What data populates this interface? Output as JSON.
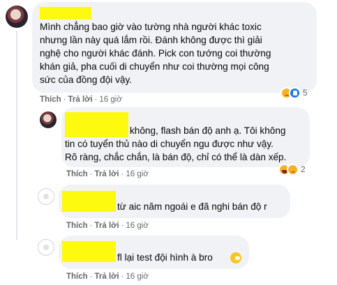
{
  "comments": [
    {
      "lines": [
        "Mình chẳng bao giờ vào tường nhà người khác toxic",
        "nhưng lần này quá lắm rồi. Đánh không được thì giải",
        "nghệ cho người khác đánh. Pick con tướng coi thường",
        "khán giả, pha cuối di chuyển như coi thường mọi công",
        "sức của đồng đội vậy."
      ],
      "like_label": "Thích",
      "reply_label": "Trả lời",
      "time": "16 giờ",
      "reaction_icons": [
        "sad-reaction-icon",
        "like-reaction-icon"
      ],
      "reaction_count": "5"
    },
    {
      "lines": [
        "không, flash bán độ anh ạ. Tôi không",
        "tin có tuyển thủ nào di chuyển ngu được như vậy.",
        "Rõ ràng, chắc chắn, là bán độ, chỉ có thể là dàn xếp."
      ],
      "like_label": "Thích",
      "reply_label": "Trả lời",
      "time": "16 giờ",
      "reaction_icons": [
        "laugh-reaction-icon",
        "sad-reaction-icon"
      ],
      "reaction_count": "2"
    },
    {
      "lines": [
        "từ aic năm ngoái e đã nghi bán độ r"
      ],
      "like_label": "Thích",
      "reply_label": "Trả lời",
      "time": "16 giờ"
    },
    {
      "lines": [
        "fl lại test đội hình à bro"
      ],
      "like_label": "Thích",
      "reply_label": "Trả lời",
      "time": "16 giờ",
      "inline_emoji": "grin-emoji-icon"
    }
  ],
  "colors": {
    "bubble": "#f0f2f5",
    "redaction": "#fdfa0f",
    "meta_text": "#65676b",
    "like_blue": "#1877f2",
    "reaction_yellow": "#f7b125"
  }
}
